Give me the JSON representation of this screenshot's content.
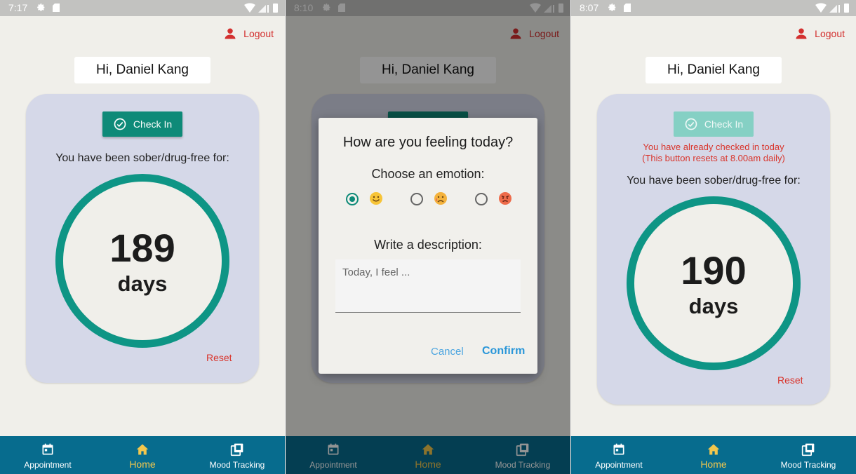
{
  "screens": [
    {
      "status_time": "7:17",
      "logout_label": "Logout",
      "greeting": "Hi, Daniel Kang",
      "checkin_label": "Check In",
      "sober_text": "You have been sober/drug-free for:",
      "days_count": "189",
      "days_label": "days",
      "reset_label": "Reset",
      "nav": {
        "appointment": "Appointment",
        "home": "Home",
        "mood": "Mood Tracking"
      }
    },
    {
      "status_time": "8:10",
      "logout_label": "Logout",
      "greeting": "Hi, Daniel Kang",
      "dialog": {
        "title": "How are you feeling today?",
        "emotion_prompt": "Choose an emotion:",
        "emotions": [
          "happy",
          "sad",
          "angry"
        ],
        "selected_emotion": "happy",
        "description_prompt": "Write a description:",
        "description_placeholder": "Today, I feel ...",
        "cancel_label": "Cancel",
        "confirm_label": "Confirm"
      },
      "nav": {
        "appointment": "Appointment",
        "home": "Home",
        "mood": "Mood Tracking"
      }
    },
    {
      "status_time": "8:07",
      "logout_label": "Logout",
      "greeting": "Hi, Daniel Kang",
      "checkin_label": "Check In",
      "checkin_warning_line1": "You have already checked in today",
      "checkin_warning_line2": "(This button resets at 8.00am daily)",
      "sober_text": "You have been sober/drug-free for:",
      "days_count": "190",
      "days_label": "days",
      "reset_label": "Reset",
      "nav": {
        "appointment": "Appointment",
        "home": "Home",
        "mood": "Mood Tracking"
      }
    }
  ],
  "colors": {
    "accent_teal": "#0e8a78",
    "ring_teal": "#0e9585",
    "danger_red": "#d9342b",
    "nav_bg": "#076c8e",
    "nav_active": "#f2c74d",
    "card_bg": "#d5d8e8",
    "link_blue": "#2b97d9"
  },
  "icons": {
    "logout": "person-icon",
    "checkin": "check-circle-icon",
    "appointment": "calendar-icon",
    "home": "home-icon",
    "mood": "library-icon",
    "status": [
      "gear-icon",
      "sd-card-icon",
      "wifi-icon",
      "signal-icon",
      "battery-icon"
    ]
  }
}
